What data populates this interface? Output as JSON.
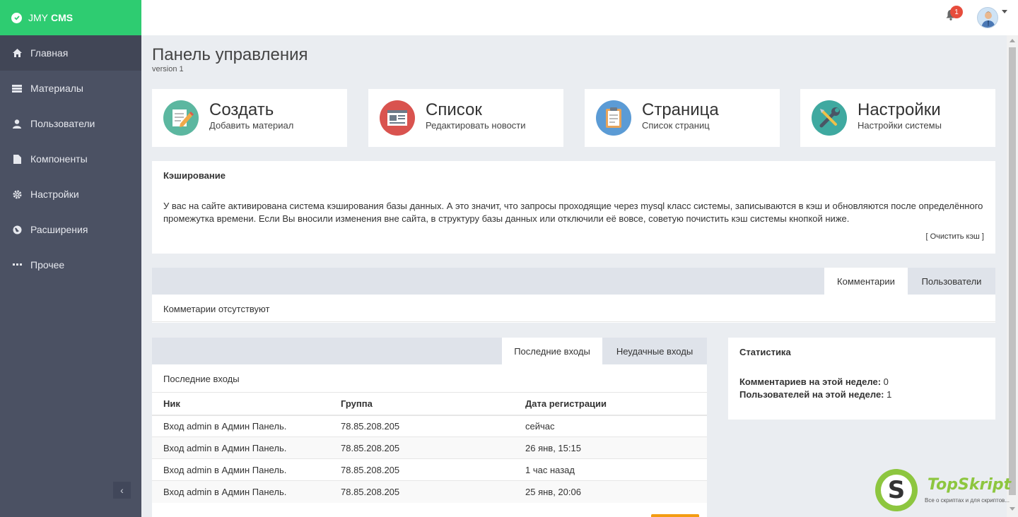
{
  "brand": {
    "light": "JMY",
    "bold": "CMS"
  },
  "sidebar": {
    "items": [
      {
        "label": "Главная",
        "icon": "home-icon",
        "active": true
      },
      {
        "label": "Материалы",
        "icon": "list-icon"
      },
      {
        "label": "Пользователи",
        "icon": "user-icon"
      },
      {
        "label": "Компоненты",
        "icon": "file-icon"
      },
      {
        "label": "Настройки",
        "icon": "gear-icon"
      },
      {
        "label": "Расширения",
        "icon": "globe-icon"
      },
      {
        "label": "Прочее",
        "icon": "dots-icon"
      }
    ],
    "collapse_icon": "‹"
  },
  "topbar": {
    "notification_count": "1"
  },
  "page": {
    "title": "Панель управления",
    "subtitle": "version 1"
  },
  "tiles": [
    {
      "title": "Создать",
      "subtitle": "Добавить материал",
      "icon": "pencil-note-icon",
      "color": "#5cb7a0"
    },
    {
      "title": "Список",
      "subtitle": "Редактировать новости",
      "icon": "newspaper-icon",
      "color": "#d9534f"
    },
    {
      "title": "Страница",
      "subtitle": "Список страниц",
      "icon": "clipboard-icon",
      "color": "#5b9bd5"
    },
    {
      "title": "Настройки",
      "subtitle": "Настройки системы",
      "icon": "tools-icon",
      "color": "#3fa9a0"
    }
  ],
  "cache": {
    "title": "Кэширование",
    "text": "У вас на сайте активирована система кэширования базы данных. А это значит, что запросы проходящие через mysql класс системы, записываются в кэш и обновляются после определённого промежутка времени. Если Вы вносили изменения вне сайта, в структуру базы данных или отключили её вовсе, советую почистить кэш системы кнопкой ниже.",
    "clear_button": "[ Очистить кэш ]"
  },
  "comments_panel": {
    "tabs": [
      "Комментарии",
      "Пользователи"
    ],
    "content": "Комметарии отсутствуют"
  },
  "logins_panel": {
    "tabs": [
      "Последние входы",
      "Неудачные входы"
    ],
    "caption": "Последние входы",
    "columns": [
      "Ник",
      "Группа",
      "Дата регистрации"
    ],
    "rows": [
      [
        "Вход admin в Админ Панель.",
        "78.85.208.205",
        "сейчас"
      ],
      [
        "Вход admin в Админ Панель.",
        "78.85.208.205",
        "26 янв, 15:15"
      ],
      [
        "Вход admin в Админ Панель.",
        "78.85.208.205",
        "1 час назад"
      ],
      [
        "Вход admin в Админ Панель.",
        "78.85.208.205",
        "25 янв, 20:06"
      ]
    ]
  },
  "stats": {
    "title": "Статистика",
    "comments_label": "Комментариев на этой неделе:",
    "comments_value": "0",
    "users_label": "Пользователей на этой неделе:",
    "users_value": "1"
  },
  "watermark": {
    "letter": "S",
    "name": "TopSkript",
    "tagline": "Все о скриптах и для скриптов..."
  }
}
